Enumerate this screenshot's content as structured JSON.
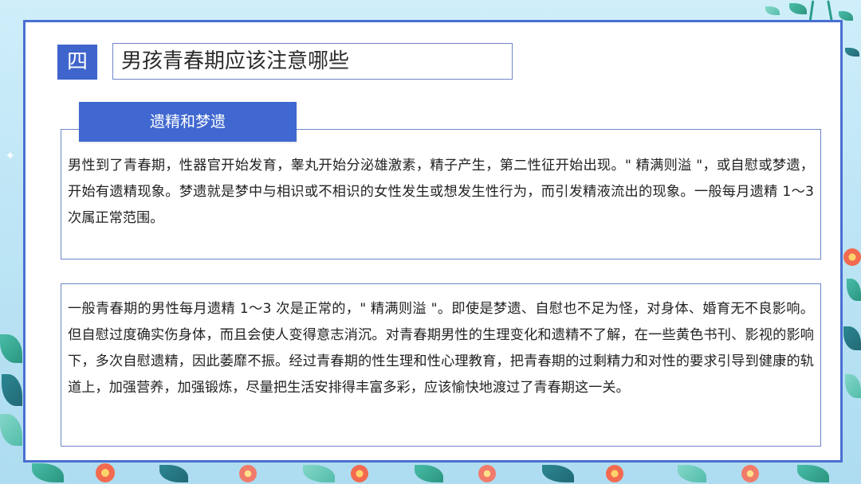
{
  "section": {
    "number": "四",
    "title": "男孩青春期应该注意哪些"
  },
  "block1": {
    "tag": "遗精和梦遗",
    "text": "男性到了青春期，性器官开始发育，睾丸开始分泌雄激素，精子产生，第二性征开始出现。\" 精满则溢 \"，或自慰或梦遗，开始有遗精现象。梦遗就是梦中与相识或不相识的女性发生或想发生性行为，而引发精液流出的现象。一般每月遗精 1～3 次属正常范围。"
  },
  "block2": {
    "text": "一般青春期的男性每月遗精 1～3 次是正常的，\" 精满则溢 \"。即使是梦遗、自慰也不足为怪，对身体、婚育无不良影响。但自慰过度确实伤身体，而且会使人变得意志消沉。对青春期男性的生理变化和遗精不了解，在一些黄色书刊、影视的影响下，多次自慰遗精，因此萎靡不振。经过青春期的性生理和性心理教育，把青春期的过剩精力和对性的要求引导到健康的轨道上，加强营养，加强锻炼，尽量把生活安排得丰富多彩，应该愉快地渡过了青春期这一关。"
  },
  "colors": {
    "accent": "#3f64cb",
    "frame": "#4a6fd1",
    "background": "#bfe6f6"
  }
}
